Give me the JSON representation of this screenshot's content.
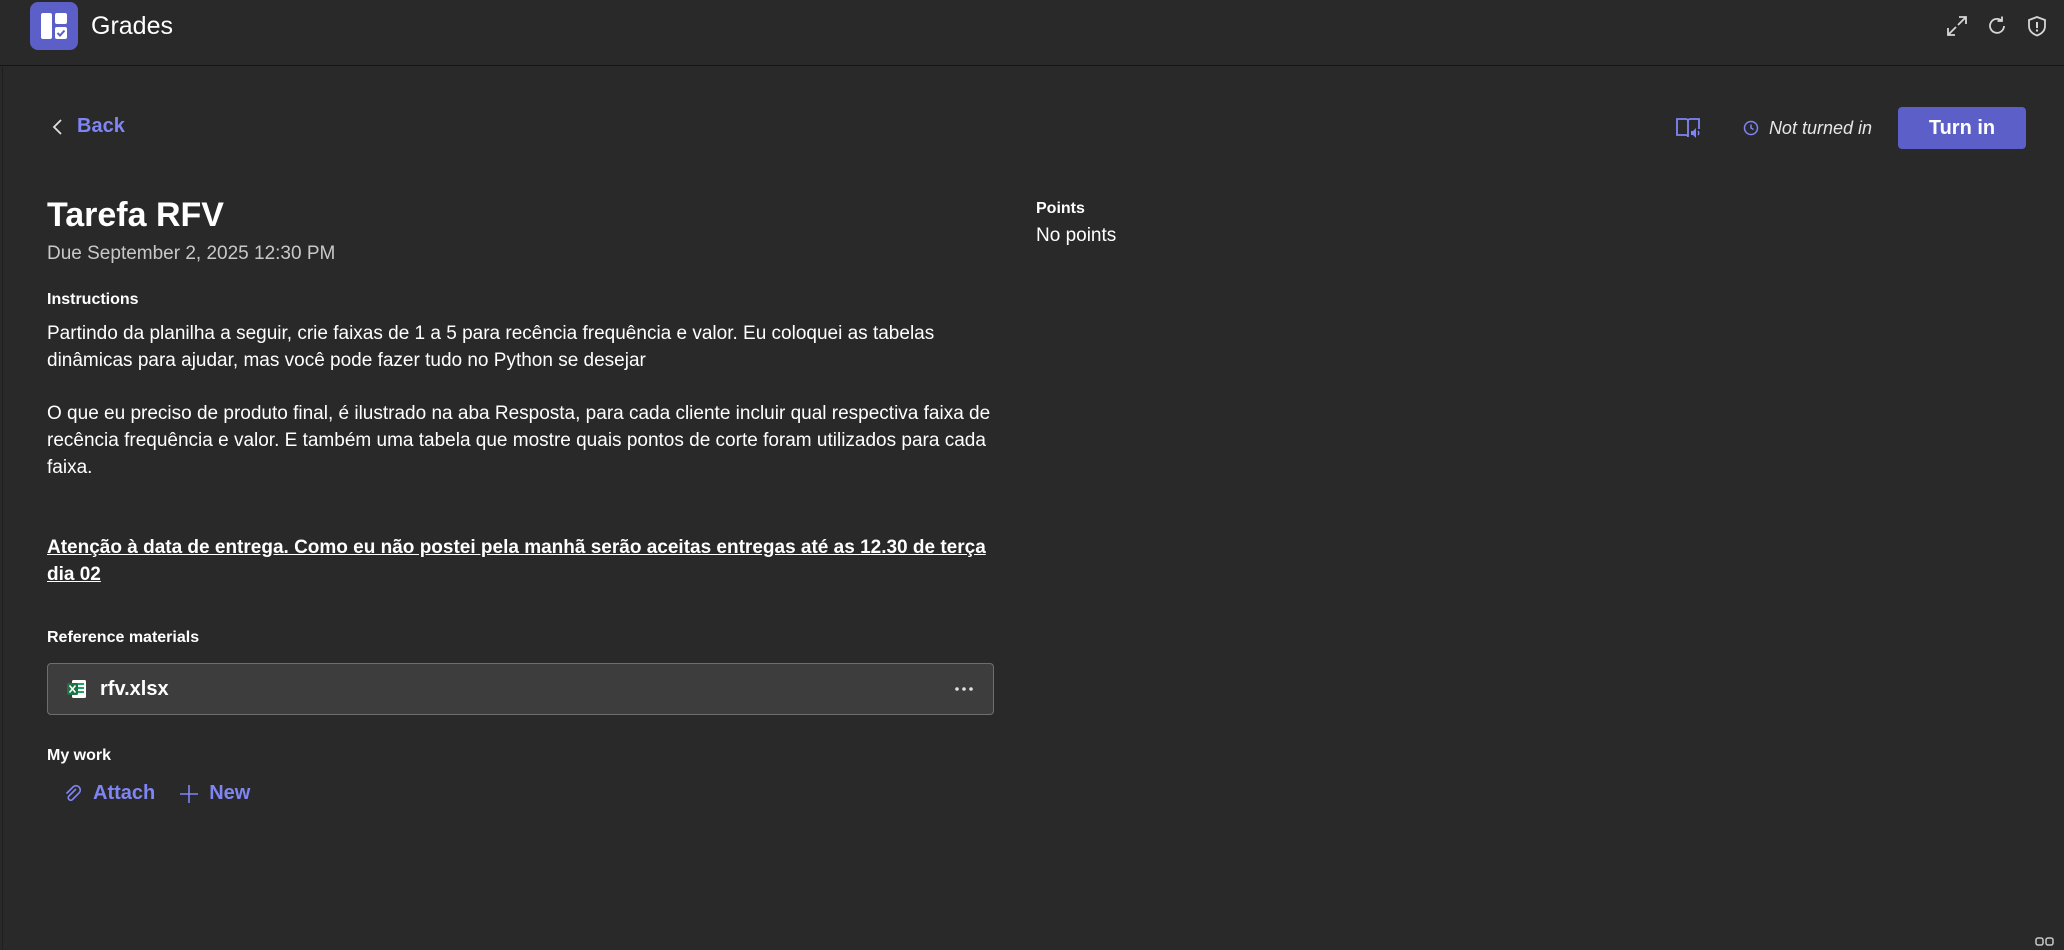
{
  "app": {
    "title": "Grades",
    "icon": "grades-app-icon"
  },
  "topbar": {
    "icons": [
      "expand-icon",
      "refresh-icon",
      "shield-icon"
    ]
  },
  "nav": {
    "back_label": "Back"
  },
  "header_actions": {
    "immersive_icon": "immersive-reader-icon",
    "status_text": "Not turned in",
    "turn_in_label": "Turn in"
  },
  "assignment": {
    "title": "Tarefa RFV",
    "due": "Due September 2, 2025 12:30 PM",
    "instructions_label": "Instructions",
    "instructions_p1": "Partindo da planilha a seguir, crie faixas de 1 a 5 para recência frequência e valor. Eu coloquei as tabelas dinâmicas para ajudar, mas você pode fazer tudo no Python se desejar",
    "instructions_p2": "O que eu preciso de produto final, é ilustrado na aba Resposta, para cada cliente incluir qual respectiva faixa de recência frequência e valor. E também uma tabela que mostre quais pontos de corte foram utilizados para cada faixa.",
    "instructions_alert": "Atenção à data de entrega. Como eu não postei pela manhã serão aceitas entregas até as 12.30 de terça dia 02",
    "reference_label": "Reference materials",
    "reference_files": [
      {
        "name": "rfv.xlsx",
        "icon": "excel-file-icon"
      }
    ],
    "mywork_label": "My work",
    "attach_label": "Attach",
    "new_label": "New"
  },
  "points": {
    "label": "Points",
    "value": "No points"
  },
  "colors": {
    "background": "#292929",
    "accent": "#5b5fc7",
    "link": "#7f85f5",
    "card": "#3d3d3d",
    "excel_green": "#1f7244"
  }
}
